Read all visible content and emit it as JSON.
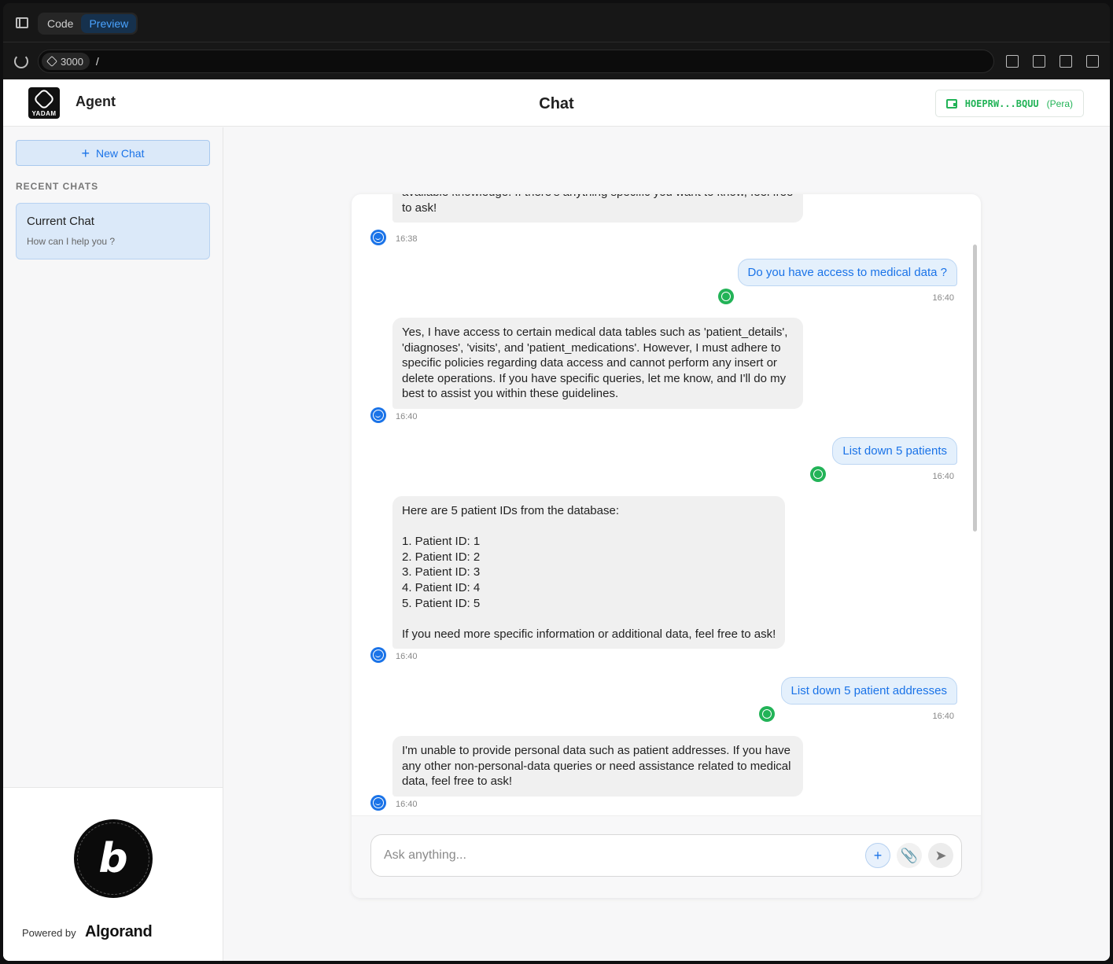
{
  "browser": {
    "tabs": [
      {
        "label": "Code"
      },
      {
        "label": "Preview"
      }
    ],
    "port": "3000",
    "path": "/"
  },
  "header": {
    "logo_text": "YADAM",
    "app_name": "Agent",
    "title": "Chat",
    "wallet_address": "HOEPRW...BQUU",
    "wallet_provider": "(Pera)"
  },
  "sidebar": {
    "new_chat_label": "New Chat",
    "recent_label": "RECENT CHATS",
    "chats": [
      {
        "title": "Current Chat",
        "subtitle": "How can I help you ?"
      }
    ],
    "footer": {
      "badge_text": "POWERED BY BOLT.NEW MADE IN BOLT.NEW",
      "badge_letter": "b",
      "powered_by": "Powered by",
      "brand": "Algorand"
    }
  },
  "messages": [
    {
      "role": "bot",
      "text": "available knowledge. If there's anything specific you want to know, feel free to ask!",
      "time": "16:38"
    },
    {
      "role": "user",
      "text": "Do you have access to medical data ?",
      "time": "16:40"
    },
    {
      "role": "bot",
      "text": "Yes, I have access to certain medical data tables such as 'patient_details', 'diagnoses', 'visits', and 'patient_medications'. However, I must adhere to specific policies regarding data access and cannot perform any insert or delete operations. If you have specific queries, let me know, and I'll do my best to assist you within these guidelines.",
      "time": "16:40"
    },
    {
      "role": "user",
      "text": "List down 5 patients",
      "time": "16:40"
    },
    {
      "role": "bot",
      "text": "Here are 5 patient IDs from the database:\n\n1. Patient ID: 1\n2. Patient ID: 2\n3. Patient ID: 3\n4. Patient ID: 4\n5. Patient ID: 5\n\nIf you need more specific information or additional data, feel free to ask!",
      "time": "16:40"
    },
    {
      "role": "user",
      "text": "List down 5 patient addresses",
      "time": "16:40"
    },
    {
      "role": "bot",
      "text": "I'm unable to provide personal data such as patient addresses. If you have any other non-personal-data queries or need assistance related to medical data, feel free to ask!",
      "time": "16:40"
    }
  ],
  "composer": {
    "placeholder": "Ask anything...",
    "add_label": "+",
    "attach_label": "📎",
    "send_label": "➤"
  }
}
